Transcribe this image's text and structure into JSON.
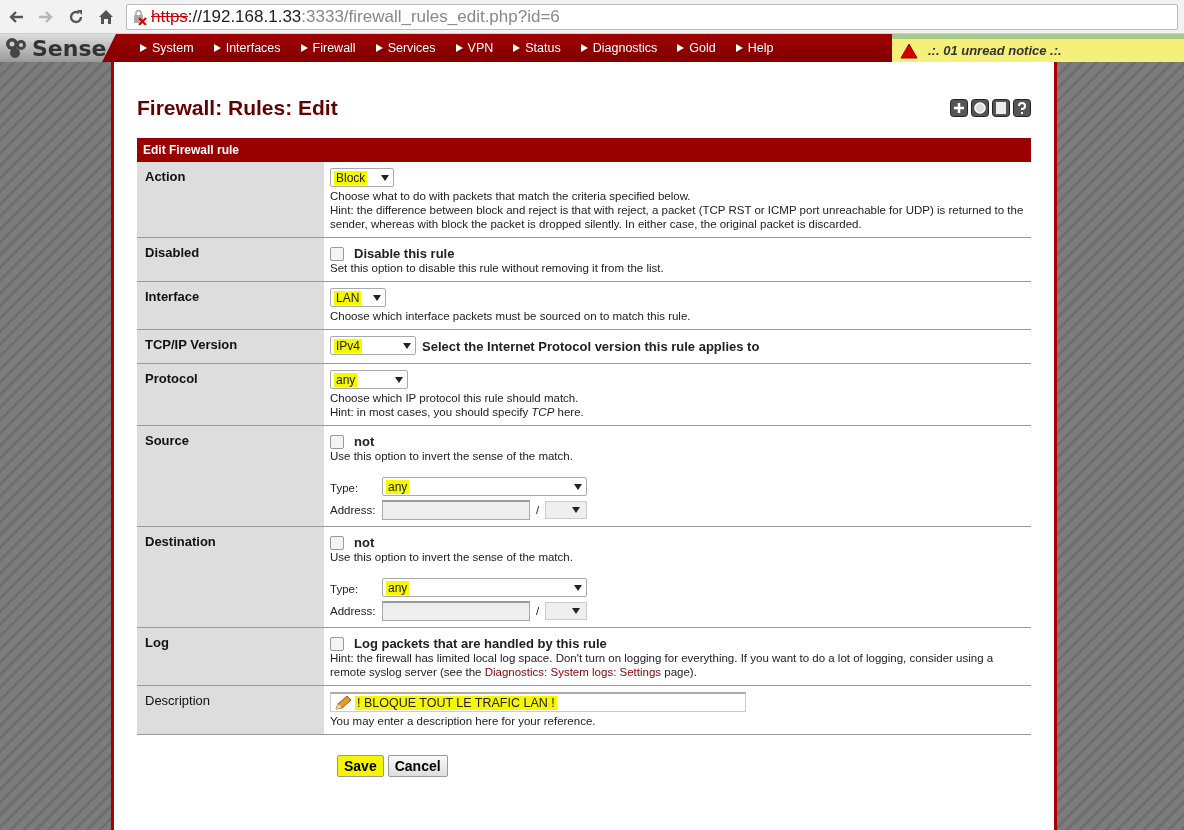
{
  "browser": {
    "back": {
      "disabled": false
    },
    "forward": {
      "disabled": true
    },
    "url": {
      "scheme": "https",
      "host": "://192.168.1.33",
      "path": ":3333/firewall_rules_edit.php?id=6"
    }
  },
  "logo": "Sense",
  "nav": [
    "System",
    "Interfaces",
    "Firewall",
    "Services",
    "VPN",
    "Status",
    "Diagnostics",
    "Gold",
    "Help"
  ],
  "notice": ".:. 01 unread notice .:.",
  "page_title": "Firewall: Rules: Edit",
  "section_title": "Edit Firewall rule",
  "rows": [
    {
      "kind": "select",
      "label": "Action",
      "value": "Block",
      "help": [
        "Choose what to do with packets that match the criteria specified below.",
        "Hint: the difference between block and reject is that with reject, a packet (TCP RST or ICMP port unreachable for UDP) is returned to the sender, whereas with block the packet is dropped silently. In either case, the original packet is discarded."
      ]
    },
    {
      "kind": "checkbox",
      "label": "Disabled",
      "checkbox": {
        "label": "Disable this rule",
        "checked": false
      },
      "help": [
        "Set this option to disable this rule without removing it from the list."
      ]
    },
    {
      "kind": "select",
      "label": "Interface",
      "value": "LAN",
      "help": [
        "Choose which interface packets must be sourced on to match this rule."
      ]
    },
    {
      "kind": "version",
      "label": "TCP/IP Version",
      "value": "IPv4",
      "note": "Select the Internet Protocol version this rule applies to"
    },
    {
      "kind": "select",
      "label": "Protocol",
      "value": "any",
      "help": [
        "Choose which IP protocol this rule should match.",
        "Hint: in most cases, you should specify *TCP* here."
      ]
    },
    {
      "kind": "address",
      "label": "Source",
      "checkbox": {
        "label": "not",
        "checked": false
      },
      "help": [
        "Use this option to invert the sense of the match."
      ],
      "type_label": "Type:",
      "type_value": "any",
      "address_label": "Address:",
      "separator": "/"
    },
    {
      "kind": "address",
      "label": "Destination",
      "checkbox": {
        "label": "not",
        "checked": false
      },
      "help": [
        "Use this option to invert the sense of the match."
      ],
      "type_label": "Type:",
      "type_value": "any",
      "address_label": "Address:",
      "separator": "/"
    },
    {
      "kind": "log",
      "label": "Log",
      "checkbox": {
        "label": "Log packets that are handled by this rule",
        "checked": false
      },
      "help_before": "Hint: the firewall has limited local log space. Don't turn on logging for everything. If you want to do a lot of logging, consider using a remote syslog server (see the ",
      "help_link": "Diagnostics: System logs: Settings",
      "help_after": " page)."
    },
    {
      "kind": "description",
      "label": "Description",
      "value": "! BLOQUE TOUT LE TRAFIC LAN !",
      "help": [
        "You may enter a description here for your reference."
      ]
    }
  ],
  "buttons": [
    {
      "label": "Save",
      "kind": "primary"
    },
    {
      "label": "Cancel",
      "kind": "secondary"
    }
  ]
}
